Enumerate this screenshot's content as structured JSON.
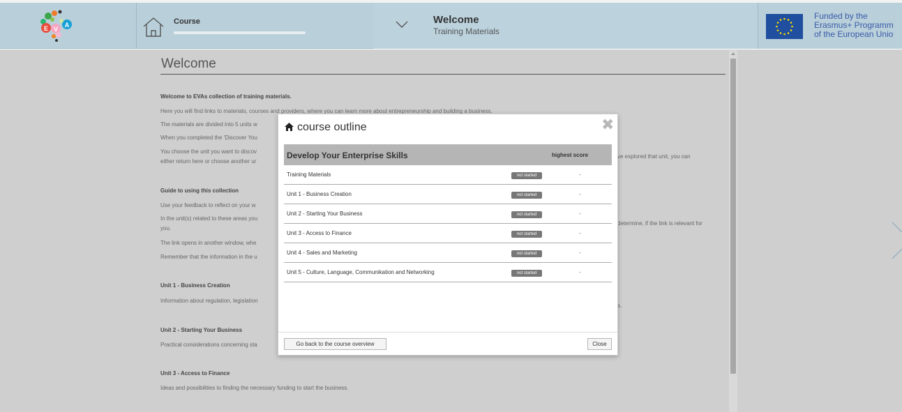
{
  "header": {
    "logo_letters": [
      "E",
      "V",
      "A"
    ],
    "course_label": "Course",
    "course_progress": 0,
    "section_title": "Welcome",
    "section_subtitle": "Training Materials",
    "eu_lines": [
      "Funded by the",
      "Erasmus+ Programm",
      "of the European Unio"
    ]
  },
  "page": {
    "title": "Welcome",
    "paragraphs": [
      {
        "text": "Welcome to EVAs collection of training materials.",
        "bold": true
      },
      {
        "text": "Here you will find links to materials, courses and providers, where you can learn more about entrepreneurship and building a business.",
        "bold": false
      },
      {
        "text": "The materials are divided into 5 units w",
        "bold": false
      },
      {
        "text": "When you completed the 'Discover You",
        "bold": false
      },
      {
        "text": "You choose the unit you want to discov",
        "bold": false
      },
      {
        "text": "either return here or choose another ur",
        "bold": false
      },
      {
        "text": "Guide to using this collection",
        "bold": true
      },
      {
        "text": "Use your feedback to reflect on your w",
        "bold": false
      },
      {
        "text": "In the unit(s) related to these areas you",
        "bold": false
      },
      {
        "text": "you.",
        "bold": false
      },
      {
        "text": "The link opens in another window, whe",
        "bold": false
      },
      {
        "text": "Remember that the information in the u",
        "bold": false
      },
      {
        "text": "Unit 1 - Business Creation",
        "bold": true
      },
      {
        "text": "Information about regulation, legislation",
        "bold": false
      },
      {
        "text": "Unit 2 - Starting Your Business",
        "bold": true
      },
      {
        "text": "Practical considerations concerning sta",
        "bold": false
      },
      {
        "text": "Unit 3 - Access to Finance",
        "bold": true
      },
      {
        "text": "Ideas and possibilities to finding the necessary funding to start the business.",
        "bold": false
      }
    ],
    "right_fragments": [
      "ve explored that unit, you can",
      "determine, if the link is relevant for",
      "s."
    ]
  },
  "modal": {
    "title": "course outline",
    "table_title": "Develop Your Enterprise Skills",
    "score_header": "highest score",
    "rows": [
      {
        "name": "Training Materials",
        "status": "not started",
        "score": "-"
      },
      {
        "name": "Unit 1 - Business Creation",
        "status": "not started",
        "score": "-"
      },
      {
        "name": "Unit 2 - Starting Your Business",
        "status": "not started",
        "score": "-"
      },
      {
        "name": "Unit 3 - Access to Finance",
        "status": "not started",
        "score": "-"
      },
      {
        "name": "Unit 4 - Sales and Marketing",
        "status": "not started",
        "score": "-"
      },
      {
        "name": "Unit 5 - Culture, Language, Communikation and Networking",
        "status": "not started",
        "score": "-"
      }
    ],
    "back_button": "Go back to the course overview",
    "close_button": "Close"
  },
  "colors": {
    "header_bg": "#b9d0db",
    "backdrop": "#cfcfcf",
    "badge": "#777777",
    "eu_blue": "#1f4f9e",
    "eu_star": "#ffdd00"
  },
  "icons": [
    "home-icon",
    "chevron-down-icon",
    "eu-flag-icon",
    "close-icon",
    "chevron-right-icon"
  ]
}
